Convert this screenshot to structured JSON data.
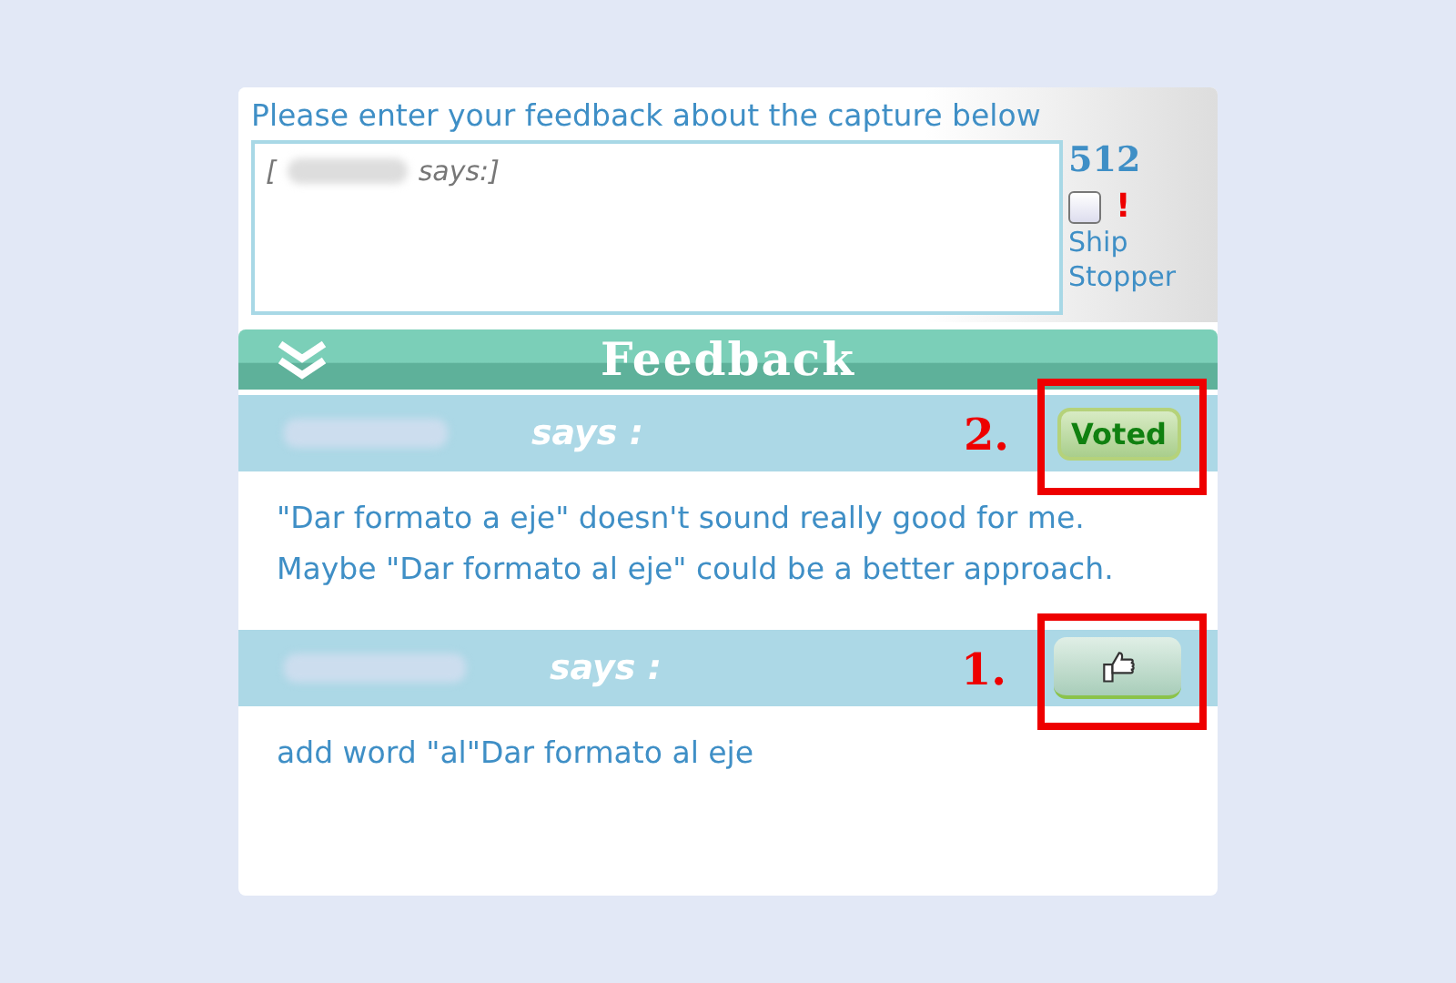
{
  "form": {
    "prompt": "Please enter your feedback about the capture below",
    "input": {
      "value_start": "[",
      "value_end": "says:]"
    },
    "counter": "512",
    "ship_stopper": {
      "mark": "!",
      "label": "Ship Stopper",
      "checked": false
    }
  },
  "feedback": {
    "title": "Feedback",
    "expanded": true,
    "comments": [
      {
        "says": "says :",
        "annotation": "2.",
        "vote": {
          "kind": "voted",
          "label": "Voted"
        },
        "text": "\"Dar formato a eje\" doesn't sound really good for me. Maybe \"Dar formato al eje\" could be a better approach."
      },
      {
        "says": "says :",
        "annotation": "1.",
        "vote": {
          "kind": "thumb"
        },
        "text": "add word \"al\"Dar formato al eje"
      }
    ]
  }
}
